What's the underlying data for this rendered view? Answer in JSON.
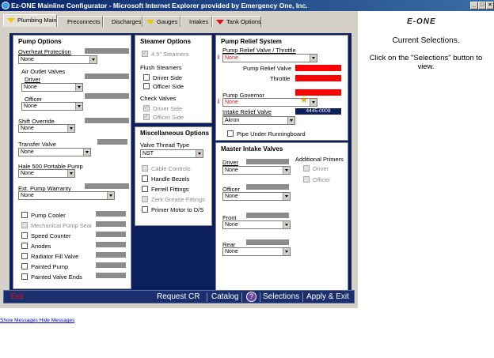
{
  "window": {
    "title": "Ez-ONE Mainline Configurator - Microsoft Internet Explorer provided by Emergency One, Inc."
  },
  "tabs": [
    {
      "label": "Plumbing Main",
      "flag": "yellow"
    },
    {
      "label": "Preconnects",
      "flag": ""
    },
    {
      "label": "Discharges",
      "flag": ""
    },
    {
      "label": "Gauges",
      "flag": "yellow"
    },
    {
      "label": "Intakes",
      "flag": ""
    },
    {
      "label": "Tank Options",
      "flag": "red"
    }
  ],
  "pump_options": {
    "title": "Pump Options",
    "overheat": {
      "label": "Overheat Protection",
      "value": "None"
    },
    "air_outlet": {
      "label": "Air Outlet Valves",
      "driver_label": "Driver",
      "driver_value": "None",
      "officer_label": "Officer",
      "officer_value": "None"
    },
    "shift_override": {
      "label": "Shift Override",
      "value": "None"
    },
    "transfer_valve": {
      "label": "Transfer Valve",
      "value": "None"
    },
    "hale_500": {
      "label": "Hale 500 Portable Pump",
      "value": "None"
    },
    "ext_warranty": {
      "label": "Ext. Pump Warranty",
      "value": "None"
    },
    "checks": [
      "Pump Cooler",
      "Mechanical Pump Seal",
      "Speed Counter",
      "Anodes",
      "Radiator Fill Valve",
      "Painted Pump",
      "Painted Valve Ends"
    ]
  },
  "steamer": {
    "title": "Steamer Options",
    "steamers_45": "4.5\" Steamers",
    "flush_label": "Flush Steamers",
    "flush": [
      "Driver Side",
      "Officer Side"
    ],
    "check_label": "Check Valves",
    "check": [
      "Driver Side",
      "Officer Side"
    ]
  },
  "misc": {
    "title": "Miscellaneous Options",
    "thread_label": "Valve Thread Type",
    "thread_value": "NST",
    "items": [
      "Cable Controls",
      "Handle Bezels",
      "Ferrell Fittings",
      "Zerk Grease Fittings",
      "Primer Motor to D/S"
    ]
  },
  "relief": {
    "title": "Pump Relief System",
    "valve_label": "Pump Relief Valve / Throttle",
    "valve_value": "None",
    "relief_valve_label": "Pump Relief Valve",
    "throttle_label": "Throttle",
    "governor_label": "Pump Governor",
    "governor_value": "None",
    "intake_label": "Intake Relief Valve",
    "intake_part": "4445-0009",
    "intake_value": "Akron",
    "pipe_label": "Pipe Under Runningboard",
    "required_mark": "i",
    "star": "★"
  },
  "master_intake": {
    "title": "Master Intake Valves",
    "additional_label": "Additional Primers",
    "additional": [
      "Driver",
      "Officer"
    ],
    "valves": [
      {
        "label": "Driver",
        "value": "None"
      },
      {
        "label": "Officer",
        "value": "None"
      },
      {
        "label": "Front",
        "value": "None"
      },
      {
        "label": "Rear",
        "value": "None"
      }
    ]
  },
  "bottom": {
    "exit": "Exit",
    "links": [
      "Request CR",
      "Catalog",
      "Selections",
      "Apply & Exit"
    ],
    "help": "?"
  },
  "right": {
    "logo": "E-ONE",
    "heading": "Current Selections.",
    "hint": "Click on the \"Selections\" button to view."
  },
  "messages": {
    "show": "Show Messages",
    "hide": "Hide Messages"
  }
}
